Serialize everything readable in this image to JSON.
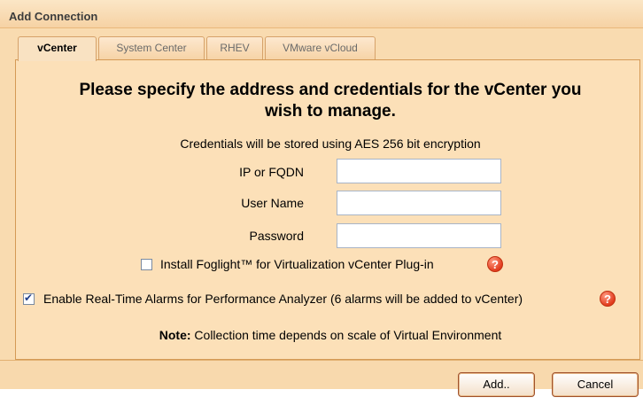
{
  "dialog": {
    "title": "Add Connection",
    "tabs": [
      {
        "label": "vCenter",
        "active": true
      },
      {
        "label": "System Center",
        "active": false
      },
      {
        "label": "RHEV",
        "active": false
      },
      {
        "label": "VMware vCloud",
        "active": false
      }
    ],
    "heading_line1": "Please specify the address and credentials for the vCenter you",
    "heading_line2": "wish to manage.",
    "subtitle": "Credentials will be stored using AES 256 bit encryption",
    "fields": {
      "ip_label": "IP or FQDN",
      "ip_value": "",
      "user_label": "User Name",
      "user_value": "",
      "password_label": "Password",
      "password_value": ""
    },
    "checkboxes": {
      "plugin_label": "Install Foglight™ for Virtualization vCenter Plug-in",
      "plugin_checked": false,
      "alarms_label": "Enable Real-Time Alarms for Performance Analyzer (6 alarms will be added to vCenter)",
      "alarms_checked": true
    },
    "note_bold": "Note:",
    "note_text": " Collection time depends on scale of Virtual Environment",
    "buttons": {
      "add": "Add..",
      "cancel": "Cancel"
    },
    "icons": {
      "help": "question-circle-icon",
      "check": "checkmark-icon"
    },
    "colors": {
      "panel": "#fce0b8",
      "border": "#d49a56",
      "help": "#e23c1e"
    }
  }
}
